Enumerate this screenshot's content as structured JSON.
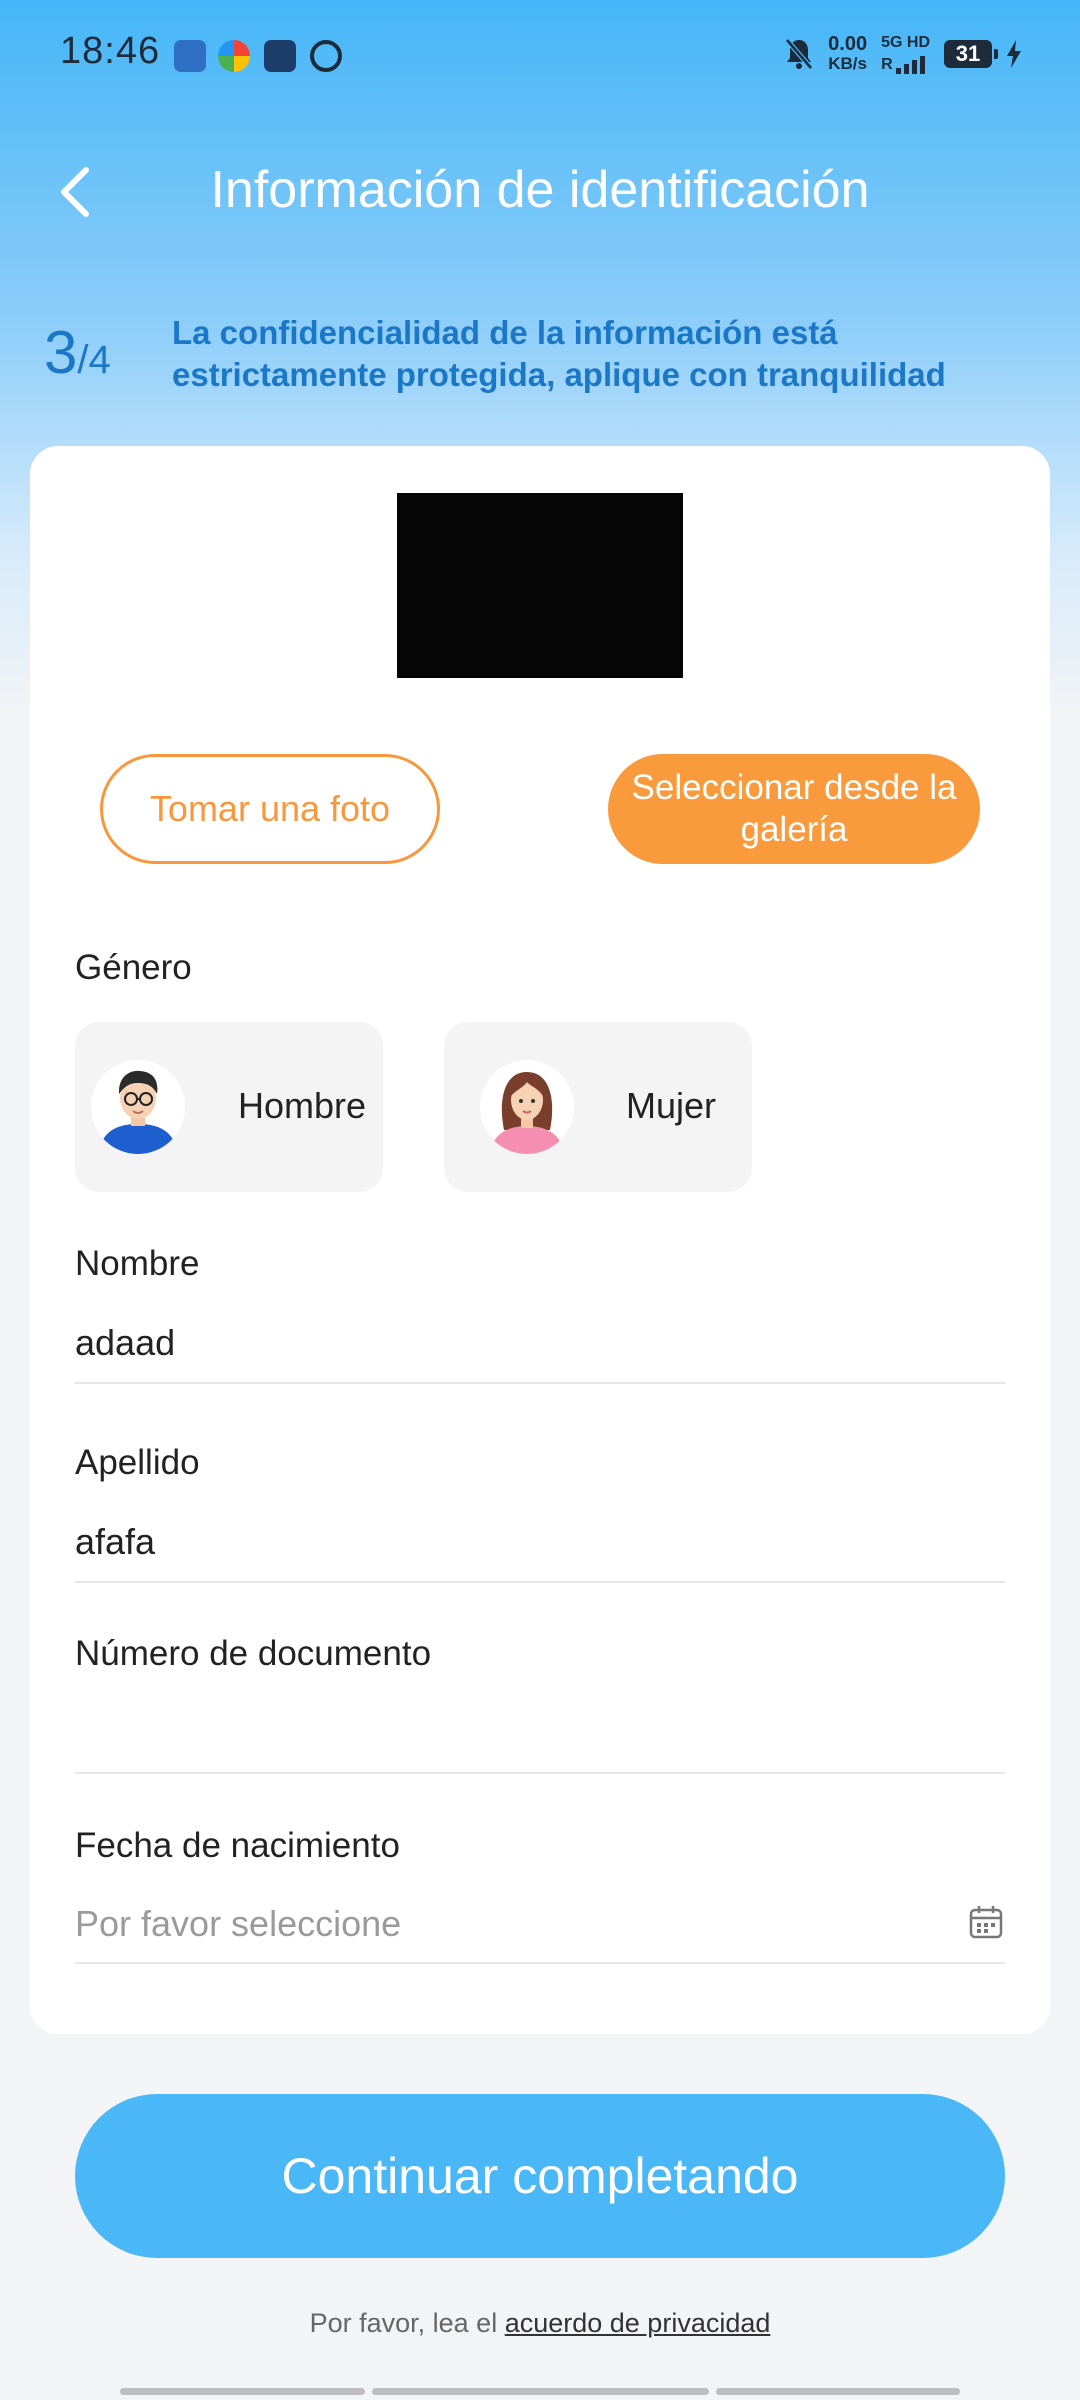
{
  "status_bar": {
    "time": "18:46",
    "net_speed": "0.00",
    "net_unit": "KB/s",
    "signal_label": "5G HD",
    "roaming": "R",
    "battery": "31"
  },
  "header": {
    "title": "Información de identificación",
    "step_current": "3",
    "step_total": "/4",
    "notice": "La confidencialidad de la información está estrictamente protegida, aplique con tranquilidad"
  },
  "photo": {
    "take_photo_label": "Tomar una foto",
    "gallery_label": "Seleccionar desde la galería"
  },
  "gender": {
    "label": "Género",
    "male_label": "Hombre",
    "female_label": "Mujer"
  },
  "form": {
    "first_name_label": "Nombre",
    "first_name_value": "adaad",
    "last_name_label": "Apellido",
    "last_name_value": "afafa",
    "document_label": "Número de documento",
    "document_value": "",
    "birth_label": "Fecha de nacimiento",
    "birth_placeholder": "Por favor seleccione"
  },
  "footer": {
    "continue_label": "Continuar completando",
    "privacy_prefix": "Por favor, lea el ",
    "privacy_link": "acuerdo de privacidad"
  },
  "colors": {
    "accent_blue": "#4ab7f7",
    "accent_orange": "#f99a3c",
    "notice_blue": "#1a78c7"
  }
}
